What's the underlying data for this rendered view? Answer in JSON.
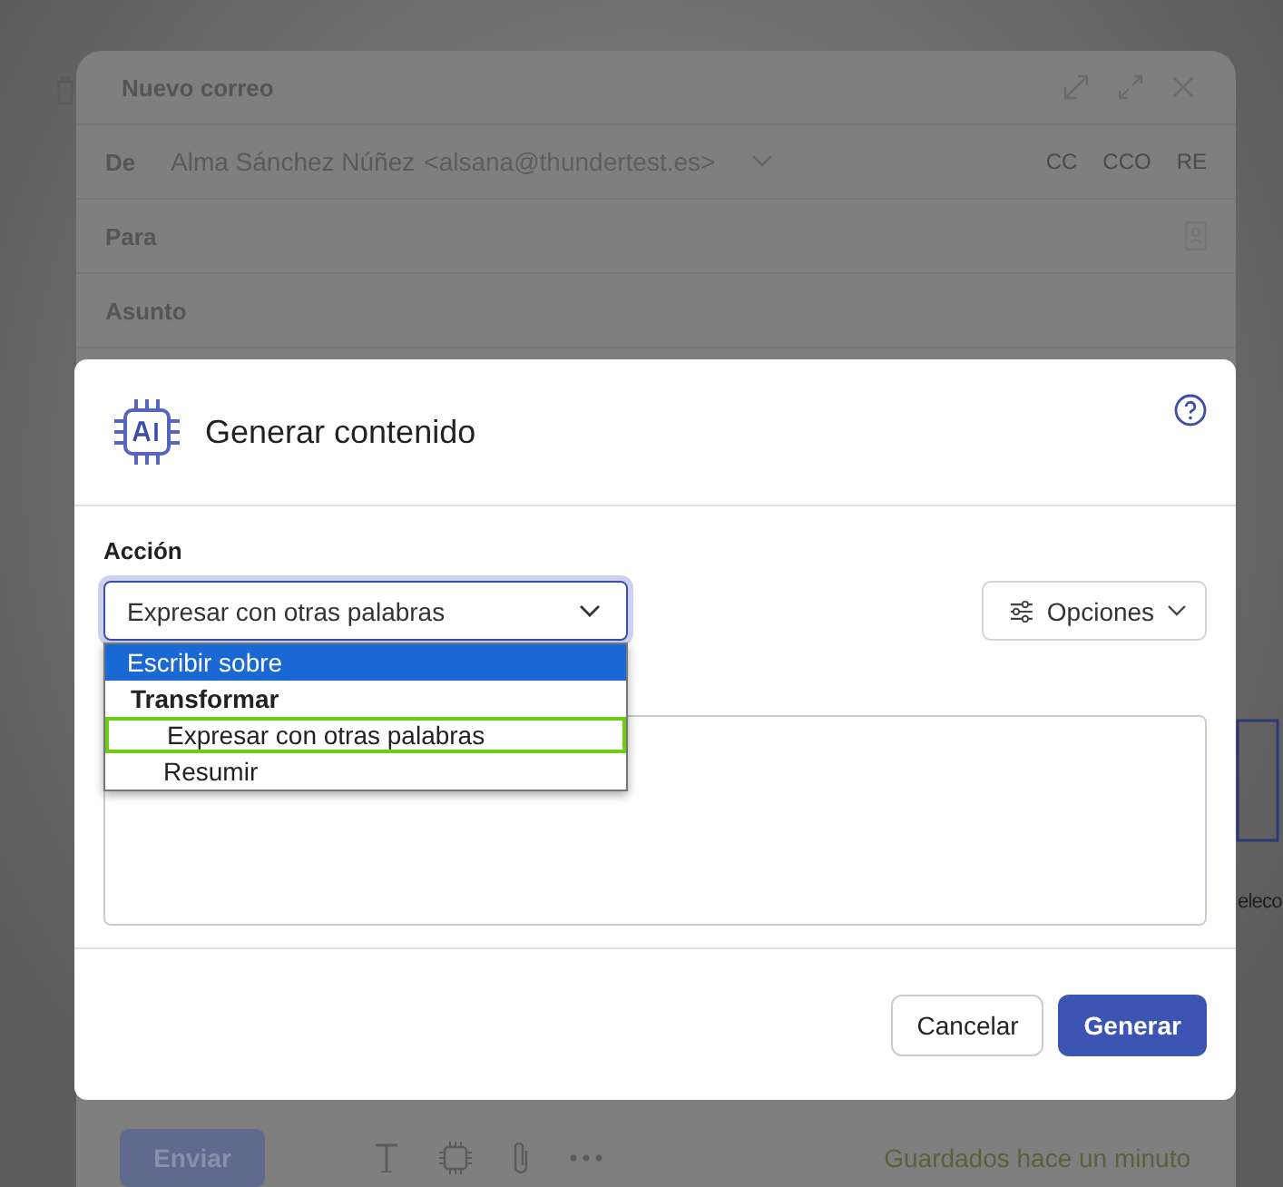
{
  "compose": {
    "title": "Nuevo correo",
    "from_label": "De",
    "from_name": "Alma Sánchez Núñez",
    "from_address": "<alsana@thundertest.es>",
    "recipient_toggles": [
      "CC",
      "CCO",
      "RE"
    ],
    "to_label": "Para",
    "subject_label": "Asunto",
    "send_button": "Enviar",
    "save_status": "Guardados hace un minuto"
  },
  "background_text": "eleco",
  "dialog": {
    "title": "Generar contenido",
    "action_label": "Acción",
    "action_select": {
      "value": "Expresar con otras palabras",
      "expanded": true
    },
    "action_options": [
      {
        "kind": "option",
        "label": "Escribir sobre",
        "selected": true,
        "focused": false
      },
      {
        "kind": "group",
        "label": "Transformar",
        "selected": false,
        "focused": false
      },
      {
        "kind": "option",
        "label": "Expresar con otras palabras",
        "selected": false,
        "focused": true
      },
      {
        "kind": "option",
        "label": "Resumir",
        "selected": false,
        "focused": false
      }
    ],
    "options_button": "Opciones",
    "buttons": [
      {
        "kind": "secondary",
        "label": "Cancelar"
      },
      {
        "kind": "primary",
        "label": "Generar"
      }
    ]
  }
}
